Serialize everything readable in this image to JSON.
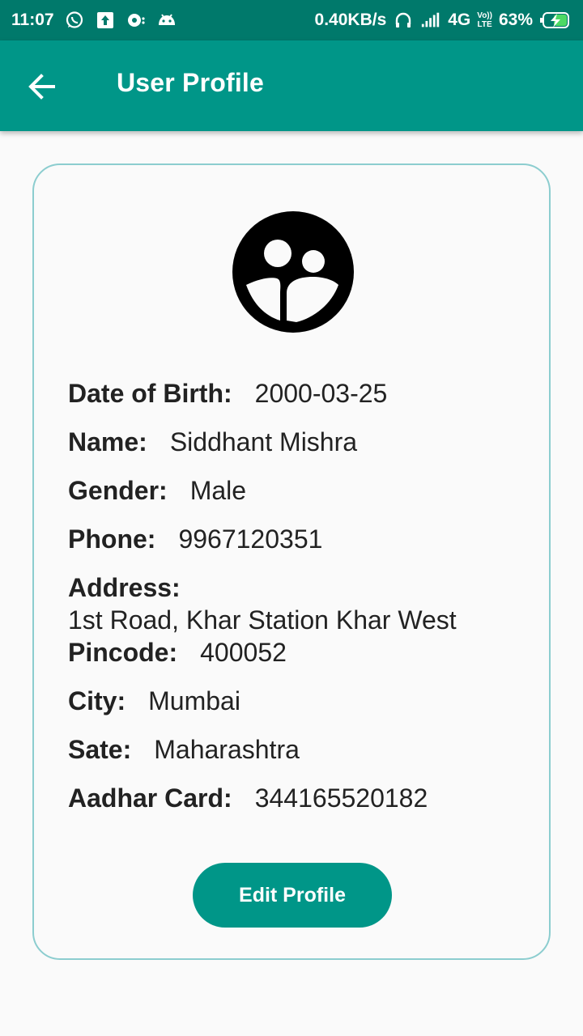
{
  "status_bar": {
    "time": "11:07",
    "network_speed": "0.40KB/s",
    "network_type": "4G",
    "volte_top": "Vo))",
    "volte_bottom": "LTE",
    "battery": "63%",
    "icons": [
      "whatsapp-icon",
      "upload-icon",
      "notification-icon",
      "android-icon",
      "headset-icon",
      "signal-icon",
      "battery-charging-icon"
    ]
  },
  "app_bar": {
    "title": "User Profile",
    "back_icon": "arrow-left-icon",
    "color": "#009688"
  },
  "profile": {
    "avatar_icon": "supervised-user-circle-icon",
    "fields": {
      "dob": {
        "label": "Date of Birth:",
        "value": "2000-03-25"
      },
      "name": {
        "label": "Name:",
        "value": "Siddhant Mishra"
      },
      "gender": {
        "label": "Gender:",
        "value": "Male"
      },
      "phone": {
        "label": "Phone:",
        "value": "9967120351"
      },
      "address": {
        "label": "Address:",
        "value": "1st Road, Khar Station Khar West"
      },
      "pincode": {
        "label": "Pincode:",
        "value": "400052"
      },
      "city": {
        "label": "City:",
        "value": "Mumbai"
      },
      "state": {
        "label": "Sate:",
        "value": "Maharashtra"
      },
      "aadhar": {
        "label": "Aadhar Card:",
        "value": "344165520182"
      }
    },
    "edit_button_label": "Edit Profile"
  }
}
